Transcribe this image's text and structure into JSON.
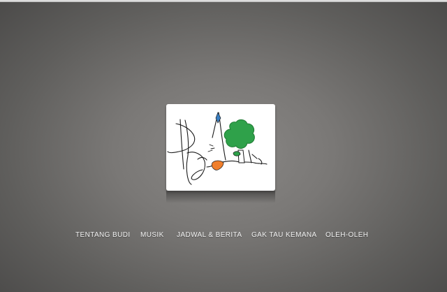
{
  "logo": {
    "signature": "Budi",
    "icons": [
      "signature-mark",
      "tree-icon",
      "kite-icon",
      "sun-icon"
    ]
  },
  "nav": {
    "items": [
      {
        "label": "TENTANG BUDI"
      },
      {
        "label": "MUSIK"
      },
      {
        "label": "JADWAL & BERITA"
      },
      {
        "label": "GAK TAU KEMANA"
      },
      {
        "label": "OLEH-OLEH"
      }
    ]
  },
  "colors": {
    "background_center": "#8a8886",
    "background_edge": "#4b4a49",
    "nav_text": "#f2f2f2",
    "tree_green": "#2fa14a",
    "sun_orange": "#f07f2c",
    "kite_blue": "#3a7fc2"
  }
}
